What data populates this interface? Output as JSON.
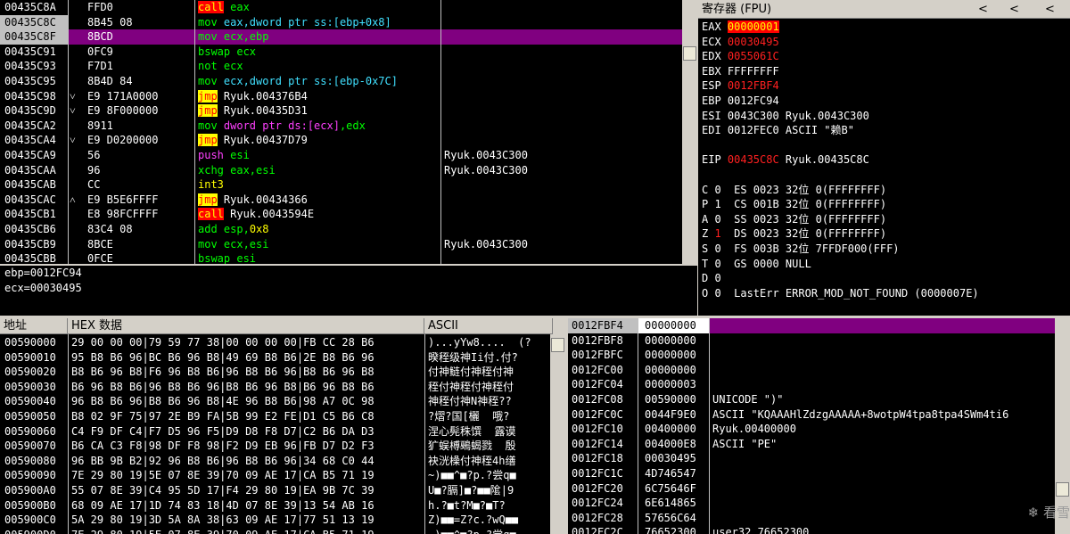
{
  "disasm": {
    "rows": [
      {
        "addr": "00435C8A",
        "mark": "",
        "hex": "FFD0",
        "asm": [
          {
            "t": "call",
            "c": "hl-r"
          },
          {
            "t": " eax",
            "c": "green"
          }
        ],
        "comment": ""
      },
      {
        "addr": "00435C8C",
        "mark": "",
        "hex": "8B45 08",
        "asm": [
          {
            "t": "mov ",
            "c": "green"
          },
          {
            "t": "eax,dword ptr ss:[ebp+0x8]",
            "c": "cyan"
          }
        ],
        "comment": ""
      },
      {
        "addr": "00435C8F",
        "mark": "",
        "hex": "8BCD",
        "asm": [
          {
            "t": "mov ",
            "c": "green"
          },
          {
            "t": "ecx,ebp",
            "c": "green"
          }
        ],
        "comment": "",
        "selected": true
      },
      {
        "addr": "00435C91",
        "mark": "",
        "hex": "0FC9",
        "asm": [
          {
            "t": "bswap ",
            "c": "green"
          },
          {
            "t": "ecx",
            "c": "green"
          }
        ],
        "comment": ""
      },
      {
        "addr": "00435C93",
        "mark": "",
        "hex": "F7D1",
        "asm": [
          {
            "t": "not ",
            "c": "green"
          },
          {
            "t": "ecx",
            "c": "green"
          }
        ],
        "comment": ""
      },
      {
        "addr": "00435C95",
        "mark": "",
        "hex": "8B4D 84",
        "asm": [
          {
            "t": "mov ",
            "c": "green"
          },
          {
            "t": "ecx,dword ptr ss:[ebp-0x7C]",
            "c": "cyan"
          }
        ],
        "comment": ""
      },
      {
        "addr": "00435C98",
        "mark": "˅",
        "hex": "E9 171A0000",
        "asm": [
          {
            "t": "jmp",
            "c": "hl-y"
          },
          {
            "t": " Ryuk.004376B4",
            "c": ""
          }
        ],
        "comment": ""
      },
      {
        "addr": "00435C9D",
        "mark": "˅",
        "hex": "E9 8F000000",
        "asm": [
          {
            "t": "jmp",
            "c": "hl-y"
          },
          {
            "t": " Ryuk.00435D31",
            "c": ""
          }
        ],
        "comment": ""
      },
      {
        "addr": "00435CA2",
        "mark": "",
        "hex": "8911",
        "asm": [
          {
            "t": "mov ",
            "c": "green"
          },
          {
            "t": "dword ptr ds:[ecx]",
            "c": "magenta"
          },
          {
            "t": ",edx",
            "c": "green"
          }
        ],
        "comment": ""
      },
      {
        "addr": "00435CA4",
        "mark": "˅",
        "hex": "E9 D0200000",
        "asm": [
          {
            "t": "jmp",
            "c": "hl-y"
          },
          {
            "t": " Ryuk.00437D79",
            "c": ""
          }
        ],
        "comment": ""
      },
      {
        "addr": "00435CA9",
        "mark": "",
        "hex": "56",
        "asm": [
          {
            "t": "push ",
            "c": "magenta"
          },
          {
            "t": "esi",
            "c": "green"
          }
        ],
        "comment": "Ryuk.0043C300"
      },
      {
        "addr": "00435CAA",
        "mark": "",
        "hex": "96",
        "asm": [
          {
            "t": "xchg ",
            "c": "green"
          },
          {
            "t": "eax,esi",
            "c": "green"
          }
        ],
        "comment": "Ryuk.0043C300"
      },
      {
        "addr": "00435CAB",
        "mark": "",
        "hex": "CC",
        "asm": [
          {
            "t": "int3",
            "c": "yellow"
          }
        ],
        "comment": ""
      },
      {
        "addr": "00435CAC",
        "mark": "˄",
        "hex": "E9 B5E6FFFF",
        "asm": [
          {
            "t": "jmp",
            "c": "hl-y"
          },
          {
            "t": " Ryuk.00434366",
            "c": ""
          }
        ],
        "comment": ""
      },
      {
        "addr": "00435CB1",
        "mark": "",
        "hex": "E8 98FCFFFF",
        "asm": [
          {
            "t": "call",
            "c": "hl-r"
          },
          {
            "t": " Ryuk.0043594E",
            "c": ""
          }
        ],
        "comment": ""
      },
      {
        "addr": "00435CB6",
        "mark": "",
        "hex": "83C4 08",
        "asm": [
          {
            "t": "add ",
            "c": "green"
          },
          {
            "t": "esp,",
            "c": "green"
          },
          {
            "t": "0x8",
            "c": "yellow"
          }
        ],
        "comment": ""
      },
      {
        "addr": "00435CB9",
        "mark": "",
        "hex": "8BCE",
        "asm": [
          {
            "t": "mov ",
            "c": "green"
          },
          {
            "t": "ecx,esi",
            "c": "green"
          }
        ],
        "comment": "Ryuk.0043C300"
      },
      {
        "addr": "00435CBB",
        "mark": "",
        "hex": "0FCE",
        "asm": [
          {
            "t": "bswap ",
            "c": "green"
          },
          {
            "t": "esi",
            "c": "green"
          }
        ],
        "comment": ""
      }
    ]
  },
  "info": {
    "lines": [
      "ebp=0012FC94",
      "ecx=00030495"
    ]
  },
  "registers": {
    "title": "寄存器 (FPU)",
    "nav": [
      "<",
      "<",
      "<"
    ],
    "rows": [
      {
        "text": "EAX ",
        "val": "00000001",
        "style": "red-bg",
        "rest": ""
      },
      {
        "text": "ECX ",
        "val": "00030495",
        "style": "red",
        "rest": ""
      },
      {
        "text": "EDX ",
        "val": "0055061C",
        "style": "red",
        "rest": ""
      },
      {
        "text": "EBX ",
        "val": "FFFFFFFF",
        "style": "",
        "rest": ""
      },
      {
        "text": "ESP ",
        "val": "0012FBF4",
        "style": "red",
        "rest": ""
      },
      {
        "text": "EBP ",
        "val": "0012FC94",
        "style": "",
        "rest": ""
      },
      {
        "text": "ESI ",
        "val": "0043C300",
        "style": "",
        "rest": " Ryuk.0043C300"
      },
      {
        "text": "EDI ",
        "val": "0012FEC0",
        "style": "",
        "rest": " ASCII \"赖B\""
      },
      {
        "text": "",
        "val": "",
        "style": "",
        "rest": ""
      },
      {
        "text": "EIP ",
        "val": "00435C8C",
        "style": "red",
        "rest": " Ryuk.00435C8C"
      },
      {
        "text": "",
        "val": "",
        "style": "",
        "rest": ""
      },
      {
        "text": "C 0  ES 0023 32位 0(FFFFFFFF)",
        "val": "",
        "style": "",
        "rest": ""
      },
      {
        "text": "P 1  CS 001B 32位 0(FFFFFFFF)",
        "val": "",
        "style": "",
        "rest": ""
      },
      {
        "text": "A 0  SS 0023 32位 0(FFFFFFFF)",
        "val": "",
        "style": "",
        "rest": ""
      },
      {
        "text": "Z ",
        "val": "1",
        "style": "red",
        "rest": "  DS 0023 32位 0(FFFFFFFF)"
      },
      {
        "text": "S 0  FS 003B 32位 7FFDF000(FFF)",
        "val": "",
        "style": "",
        "rest": ""
      },
      {
        "text": "T 0  GS 0000 NULL",
        "val": "",
        "style": "",
        "rest": ""
      },
      {
        "text": "D 0",
        "val": "",
        "style": "",
        "rest": ""
      },
      {
        "text": "O 0  LastErr ERROR_MOD_NOT_FOUND (0000007E)",
        "val": "",
        "style": "",
        "rest": ""
      },
      {
        "text": "",
        "val": "",
        "style": "",
        "rest": ""
      },
      {
        "text": "EFL ",
        "val": "00000246",
        "style": "red",
        "rest": " (NO,NB,E,BE,NS,PE,GE,LE)"
      }
    ]
  },
  "dump": {
    "headers": {
      "addr": "地址",
      "hex": "HEX 数据",
      "ascii": "ASCII"
    },
    "rows": [
      {
        "addr": "00590000",
        "hex": "29 00 00 00|79 59 77 38|00 00 00 00|FB CC 28 B6",
        "ascii": ")...yYw8....  (?"
      },
      {
        "addr": "00590010",
        "hex": "95 B8 B6 96|BC B6 96 B8|49 69 B8 B6|2E B8 B6 96",
        "ascii": "暌秷级神Ii付.付?"
      },
      {
        "addr": "00590020",
        "hex": "B8 B6 96 B8|F6 96 B8 B6|96 B8 B6 96|B8 B6 96 B8",
        "ascii": "付神鲢付神秷付神"
      },
      {
        "addr": "00590030",
        "hex": "B6 96 B8 B6|96 B8 B6 96|B8 B6 96 B8|B6 96 B8 B6",
        "ascii": "秷付神秷付神秷付"
      },
      {
        "addr": "00590040",
        "hex": "96 B8 B6 96|B8 B6 96 B8|4E 96 B8 B6|98 A7 0C 98",
        "ascii": "神秷付神N神秷??"
      },
      {
        "addr": "00590050",
        "hex": "B8 02 9F 75|97 2E B9 FA|5B 99 E2 FE|D1 C5 B6 C8",
        "ascii": "?熠?国[欐  哦?"
      },
      {
        "addr": "00590060",
        "hex": "C4 F9 DF C4|F7 D5 96 F5|D9 D8 F8 D7|C2 B6 DA D3",
        "ascii": "涅心髡秼馔  露谟"
      },
      {
        "addr": "00590070",
        "hex": "B6 CA C3 F8|98 DF F8 98|F2 D9 EB 96|FB D7 D2 F3",
        "ascii": "犷蜈榑鵐蝎戮  殷"
      },
      {
        "addr": "00590080",
        "hex": "96 BB 9B B2|92 96 B8 B6|96 B8 B6 96|34 68 C0 44",
        "ascii": "袂洸橾付神秷4h缮"
      },
      {
        "addr": "00590090",
        "hex": "7E 29 80 19|5E 07 8E 39|70 09 AE 17|CA B5 71 19",
        "ascii": "~)■■^■?p.?尝q■"
      },
      {
        "addr": "005900A0",
        "hex": "55 07 8E 39|C4 95 5D 17|F4 29 80 19|EA 9B 7C 39",
        "ascii": "U■?膈]■?■■隂|9"
      },
      {
        "addr": "005900B0",
        "hex": "68 09 AE 17|1D 74 83 18|4D 07 8E 39|13 54 AB 16",
        "ascii": "h.?■t?M■?■T?"
      },
      {
        "addr": "005900C0",
        "hex": "5A 29 80 19|3D 5A 8A 38|63 09 AE 17|77 51 13 19",
        "ascii": "Z)■■=Z?c.?wQ■■"
      },
      {
        "addr": "005900D0",
        "hex": "7E 29 80 19|5E 07 8E 39|70 09 AE 17|CA B5 71 19",
        "ascii": "~)■■^■?p.?尝q■"
      }
    ]
  },
  "stack": {
    "rows": [
      {
        "addr": "0012FBF4",
        "val": "00000000",
        "comment": "",
        "selected": true
      },
      {
        "addr": "0012FBF8",
        "val": "00000000",
        "comment": ""
      },
      {
        "addr": "0012FBFC",
        "val": "00000000",
        "comment": ""
      },
      {
        "addr": "0012FC00",
        "val": "00000000",
        "comment": ""
      },
      {
        "addr": "0012FC04",
        "val": "00000003",
        "comment": ""
      },
      {
        "addr": "0012FC08",
        "val": "00590000",
        "comment": "UNICODE \")\""
      },
      {
        "addr": "0012FC0C",
        "val": "0044F9E0",
        "comment": "ASCII \"KQAAAHlZdzgAAAAA+8wotpW4tpa8tpa4SWm4ti6"
      },
      {
        "addr": "0012FC10",
        "val": "00400000",
        "comment": "Ryuk.00400000"
      },
      {
        "addr": "0012FC14",
        "val": "004000E8",
        "comment": "ASCII \"PE\""
      },
      {
        "addr": "0012FC18",
        "val": "00030495",
        "comment": ""
      },
      {
        "addr": "0012FC1C",
        "val": "4D746547",
        "comment": ""
      },
      {
        "addr": "0012FC20",
        "val": "6C75646F",
        "comment": ""
      },
      {
        "addr": "0012FC24",
        "val": "6E614865",
        "comment": ""
      },
      {
        "addr": "0012FC28",
        "val": "57656C64",
        "comment": ""
      },
      {
        "addr": "0012FC2C",
        "val": "76652300",
        "comment": "user32.76652300"
      }
    ]
  },
  "watermark": "看雪"
}
